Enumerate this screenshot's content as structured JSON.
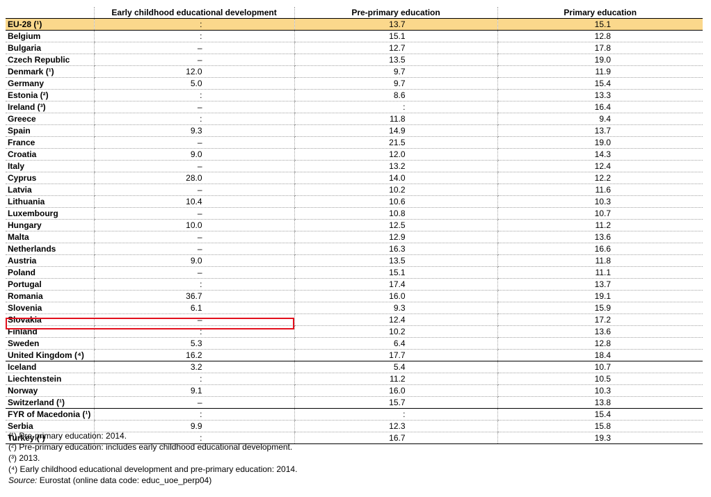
{
  "chart_data": {
    "type": "table",
    "columns": [
      "",
      "Early childhood educational development",
      "Pre-primary education",
      "Primary education"
    ],
    "rows": [
      {
        "country": "EU-28 (¹)",
        "ecd": ":",
        "pre": "13.7",
        "prim": "15.1"
      },
      {
        "country": "Belgium",
        "ecd": ":",
        "pre": "15.1",
        "prim": "12.8"
      },
      {
        "country": "Bulgaria",
        "ecd": "–",
        "pre": "12.7",
        "prim": "17.8"
      },
      {
        "country": "Czech Republic",
        "ecd": "–",
        "pre": "13.5",
        "prim": "19.0"
      },
      {
        "country": "Denmark (¹)",
        "ecd": "12.0",
        "pre": "9.7",
        "prim": "11.9"
      },
      {
        "country": "Germany",
        "ecd": "5.0",
        "pre": "9.7",
        "prim": "15.4"
      },
      {
        "country": "Estonia (²)",
        "ecd": ":",
        "pre": "8.6",
        "prim": "13.3"
      },
      {
        "country": "Ireland (³)",
        "ecd": "–",
        "pre": ":",
        "prim": "16.4"
      },
      {
        "country": "Greece",
        "ecd": ":",
        "pre": "11.8",
        "prim": "9.4"
      },
      {
        "country": "Spain",
        "ecd": "9.3",
        "pre": "14.9",
        "prim": "13.7"
      },
      {
        "country": "France",
        "ecd": "–",
        "pre": "21.5",
        "prim": "19.0"
      },
      {
        "country": "Croatia",
        "ecd": "9.0",
        "pre": "12.0",
        "prim": "14.3"
      },
      {
        "country": "Italy",
        "ecd": "–",
        "pre": "13.2",
        "prim": "12.4"
      },
      {
        "country": "Cyprus",
        "ecd": "28.0",
        "pre": "14.0",
        "prim": "12.2"
      },
      {
        "country": "Latvia",
        "ecd": "–",
        "pre": "10.2",
        "prim": "11.6"
      },
      {
        "country": "Lithuania",
        "ecd": "10.4",
        "pre": "10.6",
        "prim": "10.3"
      },
      {
        "country": "Luxembourg",
        "ecd": "–",
        "pre": "10.8",
        "prim": "10.7"
      },
      {
        "country": "Hungary",
        "ecd": "10.0",
        "pre": "12.5",
        "prim": "11.2"
      },
      {
        "country": "Malta",
        "ecd": "–",
        "pre": "12.9",
        "prim": "13.6"
      },
      {
        "country": "Netherlands",
        "ecd": "–",
        "pre": "16.3",
        "prim": "16.6"
      },
      {
        "country": "Austria",
        "ecd": "9.0",
        "pre": "13.5",
        "prim": "11.8"
      },
      {
        "country": "Poland",
        "ecd": "–",
        "pre": "15.1",
        "prim": "11.1"
      },
      {
        "country": "Portugal",
        "ecd": ":",
        "pre": "17.4",
        "prim": "13.7"
      },
      {
        "country": "Romania",
        "ecd": "36.7",
        "pre": "16.0",
        "prim": "19.1"
      },
      {
        "country": "Slovenia",
        "ecd": "6.1",
        "pre": "9.3",
        "prim": "15.9"
      },
      {
        "country": "Slovakia",
        "ecd": "–",
        "pre": "12.4",
        "prim": "17.2"
      },
      {
        "country": "Finland",
        "ecd": ":",
        "pre": "10.2",
        "prim": "13.6"
      },
      {
        "country": "Sweden",
        "ecd": "5.3",
        "pre": "6.4",
        "prim": "12.8"
      },
      {
        "country": "United Kingdom (⁴)",
        "ecd": "16.2",
        "pre": "17.7",
        "prim": "18.4"
      },
      {
        "country": "Iceland",
        "ecd": "3.2",
        "pre": "5.4",
        "prim": "10.7"
      },
      {
        "country": "Liechtenstein",
        "ecd": ":",
        "pre": "11.2",
        "prim": "10.5"
      },
      {
        "country": "Norway",
        "ecd": "9.1",
        "pre": "16.0",
        "prim": "10.3"
      },
      {
        "country": "Switzerland (¹)",
        "ecd": "–",
        "pre": "15.7",
        "prim": "13.8"
      },
      {
        "country": "FYR of Macedonia (¹)",
        "ecd": ":",
        "pre": ":",
        "prim": "15.4"
      },
      {
        "country": "Serbia",
        "ecd": "9.9",
        "pre": "12.3",
        "prim": "15.8"
      },
      {
        "country": "Turkey (¹)",
        "ecd": ":",
        "pre": "16.7",
        "prim": "19.3"
      }
    ],
    "highlighted_row": "Sweden",
    "highlight_color": "#e2101d",
    "eu_row_color": "#fbd88c"
  },
  "notes": [
    "(¹) Pre-primary education: 2014.",
    "(²) Pre-primary education: includes early childhood educational development.",
    "(³) 2013.",
    "(⁴) Early childhood educational development and pre-primary education: 2014."
  ],
  "source": {
    "label": "Source:",
    "text": "Eurostat (online data code: educ_uoe_perp04)"
  }
}
